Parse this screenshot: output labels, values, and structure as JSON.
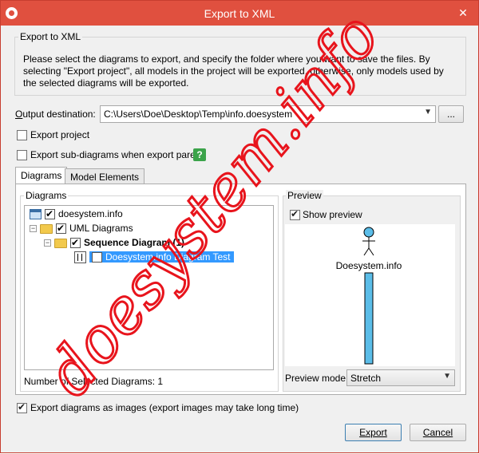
{
  "window": {
    "title": "Export to XML",
    "close_glyph": "✕",
    "title_color": "#e0503f"
  },
  "intro": {
    "group_title": "Export to XML",
    "text": "Please select the diagrams to export, and specify the folder where you want to save the files. By selecting \"Export project\", all models in the project will be exported, otherwise, only models used by the selected diagrams will be exported."
  },
  "output": {
    "label": "Output destination:",
    "value": "C:\\Users\\Doe\\Desktop\\Temp\\info.doesystem",
    "browse_label": "..."
  },
  "options": {
    "export_project": {
      "label": "Export project",
      "checked": false
    },
    "export_subdiagrams": {
      "label": "Export sub-diagrams when export parent",
      "checked": false
    },
    "help_glyph": "?"
  },
  "tabs": [
    {
      "label": "Diagrams",
      "active": true
    },
    {
      "label": "Model Elements",
      "active": false
    }
  ],
  "diagrams_panel": {
    "group_title": "Diagrams",
    "tree": [
      {
        "label": "doesystem.info",
        "icon": "project-icon",
        "checked": true
      },
      {
        "label": "UML Diagrams",
        "icon": "folder-icon",
        "checked": true
      },
      {
        "label": "Sequence Diagram (1)",
        "icon": "folder-icon",
        "checked": true
      },
      {
        "label": "Doesystem.info Diagram Test",
        "icon": "sequence-diagram-icon",
        "checked": true,
        "selected": true
      }
    ],
    "count_label": "Number of Selected Diagrams: 1"
  },
  "preview": {
    "group_title": "Preview",
    "show_preview_label": "Show preview",
    "actor_name": "Doesystem.info",
    "mode_label": "Preview mode:",
    "mode_value": "Stretch",
    "lifeline_color": "#5bbde8"
  },
  "footer": {
    "export_images_label": "Export diagrams as images (export images may take long time)",
    "export_button": "Export",
    "cancel_button": "Cancel"
  },
  "watermark_text": "doesystem.info",
  "watermark_color": "#e8141c"
}
